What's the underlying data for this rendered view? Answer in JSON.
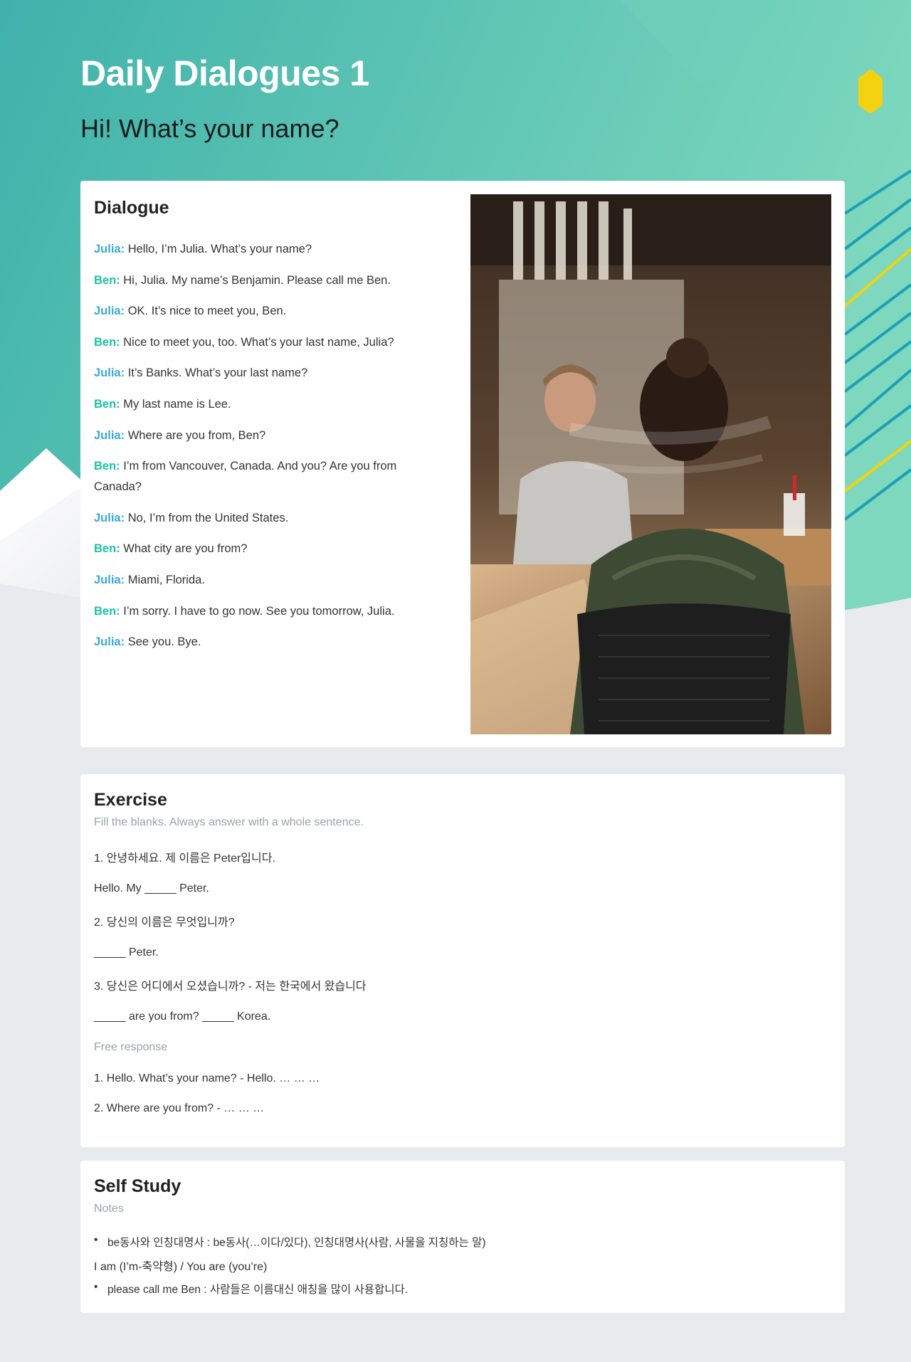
{
  "header": {
    "title": "Daily Dialogues 1",
    "subtitle": "Hi! What’s your name?"
  },
  "dialogue": {
    "heading": "Dialogue",
    "lines": [
      {
        "speaker": "Julia:",
        "text": " Hello, I’m Julia. What’s your name?"
      },
      {
        "speaker": "Ben:",
        "text": " Hi, Julia. My name’s Benjamin. Please call me Ben."
      },
      {
        "speaker": "Julia:",
        "text": " OK. It’s nice to meet you, Ben."
      },
      {
        "speaker": "Ben:",
        "text": " Nice to meet you, too. What’s your last name, Julia?"
      },
      {
        "speaker": "Julia:",
        "text": " It’s Banks. What’s your last name?"
      },
      {
        "speaker": "Ben:",
        "text": " My last name is Lee."
      },
      {
        "speaker": "Julia:",
        "text": " Where are you from, Ben?"
      },
      {
        "speaker": "Ben:",
        "text": " I’m from Vancouver, Canada. And you? Are you from Canada?"
      },
      {
        "speaker": "Julia:",
        "text": " No, I’m from the United States."
      },
      {
        "speaker": "Ben:",
        "text": " What city are you from?"
      },
      {
        "speaker": "Julia:",
        "text": " Miami, Florida."
      },
      {
        "speaker": "Ben:",
        "text": " I’m sorry. I have to go now. See you tomorrow, Julia."
      },
      {
        "speaker": "Julia:",
        "text": " See you. Bye."
      }
    ]
  },
  "exercise": {
    "heading": "Exercise",
    "instruction": "Fill the blanks. Always answer with a whole sentence.",
    "q1_prompt": "1. 안녕하세요. 제 이름은 Peter입니다.",
    "q1_answer": "Hello. My _____ Peter.",
    "q2_prompt": "2. 당신의 이름은 무엇입니까?",
    "q2_answer": "_____ Peter.",
    "q3_prompt": "3. 당신은 어디에서 오셨습니까? - 저는 한국에서 왔습니다",
    "q3_answer": "_____ are you from? _____ Korea.",
    "free_label": "Free response",
    "free_1": "1. Hello. What’s your name? - Hello. … … …",
    "free_2": "2. Where are you from? - … … …"
  },
  "self_study": {
    "heading": "Self Study",
    "notes_label": "Notes",
    "note_1": "be동사와 인칭대명사 : be동사(…이다/있다), 인칭대명사(사람, 사물을 지칭하는 말)",
    "note_1_detail": "I am (I’m-축약형) / You are (you’re)",
    "note_2": "please call me Ben : 사람들은 이름대신 애칭을 많이 사용합니다."
  },
  "colors": {
    "teal": "#4dbcb0",
    "julia": "#3aa8d8",
    "ben": "#19c3a0",
    "yellow": "#f4d20f",
    "page_bg": "#e9eaee"
  }
}
